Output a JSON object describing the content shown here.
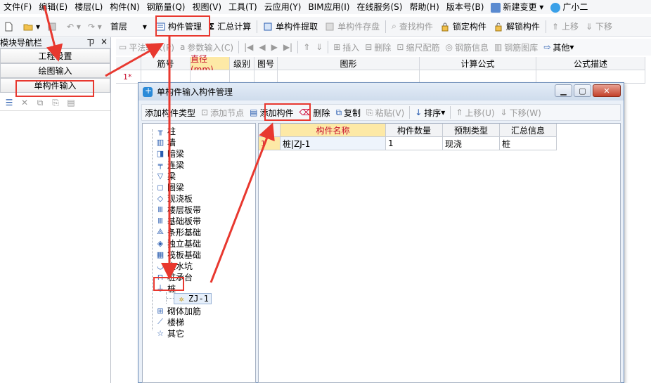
{
  "menu": [
    "文件(F)",
    "编辑(E)",
    "楼层(L)",
    "构件(N)",
    "钢筋量(Q)",
    "视图(V)",
    "工具(T)",
    "云应用(Y)",
    "BIM应用(I)",
    "在线服务(S)",
    "帮助(H)",
    "版本号(B)",
    "新建变更",
    "广小二"
  ],
  "toolbar": {
    "floor": "首层",
    "component_manage": "构件管理",
    "sum_calc": "汇总计算",
    "single_extract": "单构件提取",
    "single_save": "单构件存盘",
    "find": "查找构件",
    "lock": "锁定构件",
    "unlock": "解锁构件",
    "up": "上移",
    "down": "下移"
  },
  "nav": {
    "title": "模块导航栏",
    "pin": "ㄗ",
    "close": "×",
    "project_settings": "工程设置",
    "drawing_input": "绘图输入",
    "single_input": "单构件输入"
  },
  "tool2": [
    "平法输入(P)",
    "参数输入(C)",
    "插入",
    "删除",
    "缩尺配筋",
    "钢筋信息",
    "钢筋图库",
    "其他"
  ],
  "grid": {
    "headers": [
      "筋号",
      "直径(mm)",
      "级别",
      "图号",
      "图形",
      "计算公式",
      "公式描述"
    ],
    "row1": "1*"
  },
  "dialog": {
    "title": "单构件输入构件管理",
    "tools": [
      "添加构件类型",
      "添加节点",
      "添加构件",
      "删除",
      "复制",
      "粘贴(V)",
      "排序",
      "上移(U)",
      "下移(W)"
    ],
    "tree": [
      "柱",
      "墙",
      "暗梁",
      "连梁",
      "梁",
      "圈梁",
      "现浇板",
      "楼层板带",
      "基础板带",
      "条形基础",
      "独立基础",
      "筏板基础",
      "集水坑",
      "桩承台",
      "桩",
      "ZJ-1",
      "砌体加筋",
      "楼梯",
      "其它"
    ],
    "table": {
      "headers": [
        "构件名称",
        "构件数量",
        "预制类型",
        "汇总信息"
      ],
      "rows": [
        [
          "1",
          "桩|ZJ-1",
          "1",
          "现浇",
          "桩"
        ]
      ]
    }
  },
  "colors": {
    "accent_red": "#e8382f",
    "highlight": "#fde9a6"
  }
}
